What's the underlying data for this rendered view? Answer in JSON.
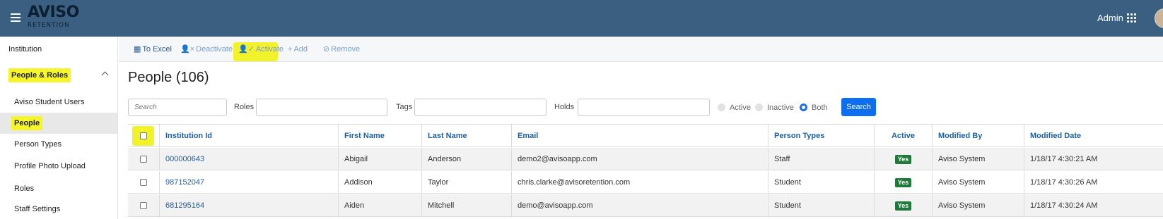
{
  "topbar": {
    "logo_line1": "AVISO",
    "logo_line2": "RETENTION",
    "user": "Admin"
  },
  "sidebar": {
    "items": [
      {
        "label": "Institution"
      },
      {
        "label": "People & Roles"
      },
      {
        "label": "Aviso Student Users"
      },
      {
        "label": "People"
      },
      {
        "label": "Person Types"
      },
      {
        "label": "Profile Photo Upload"
      },
      {
        "label": "Roles"
      },
      {
        "label": "Staff Settings"
      }
    ]
  },
  "toolbar": {
    "to_excel": "To Excel",
    "deactivate": "Deactivate",
    "activate": "Activate",
    "add": "Add",
    "remove": "Remove"
  },
  "page": {
    "title": "People (106)"
  },
  "filters": {
    "search_placeholder": "Search",
    "roles_label": "Roles",
    "tags_label": "Tags",
    "holds_label": "Holds",
    "radio_active": "Active",
    "radio_inactive": "Inactive",
    "radio_both": "Both",
    "selected": "Both",
    "search_button": "Search"
  },
  "table": {
    "columns": [
      "Institution Id",
      "First Name",
      "Last Name",
      "Email",
      "Person Types",
      "Active",
      "Modified By",
      "Modified Date"
    ],
    "rows": [
      {
        "id": "000000643",
        "first": "Abigail",
        "last": "Anderson",
        "email": "demo2@avisoapp.com",
        "type": "Staff",
        "active": "Yes",
        "modified_by": "Aviso System",
        "modified_date": "1/18/17 4:30:21 AM"
      },
      {
        "id": "987152047",
        "first": "Addison",
        "last": "Taylor",
        "email": "chris.clarke@avisoretention.com",
        "type": "Student",
        "active": "Yes",
        "modified_by": "Aviso System",
        "modified_date": "1/18/17 4:30:26 AM"
      },
      {
        "id": "681295164",
        "first": "Aiden",
        "last": "Mitchell",
        "email": "demo@avisoapp.com",
        "type": "Student",
        "active": "Yes",
        "modified_by": "Aviso System",
        "modified_date": "1/18/17 4:30:24 AM"
      }
    ]
  },
  "colors": {
    "topbar": "#3b5f80",
    "link": "#1d5fa8",
    "highlight": "#f2f22a",
    "search_button": "#0d6ef0",
    "yes_badge": "#1f7a3a"
  },
  "icons": {
    "menu": "hamburger-icon",
    "apps": "grid-icon",
    "excel": "excel-icon",
    "deactivate": "user-x-icon",
    "activate": "user-check-icon",
    "add": "plus-icon",
    "remove": "ban-icon"
  }
}
